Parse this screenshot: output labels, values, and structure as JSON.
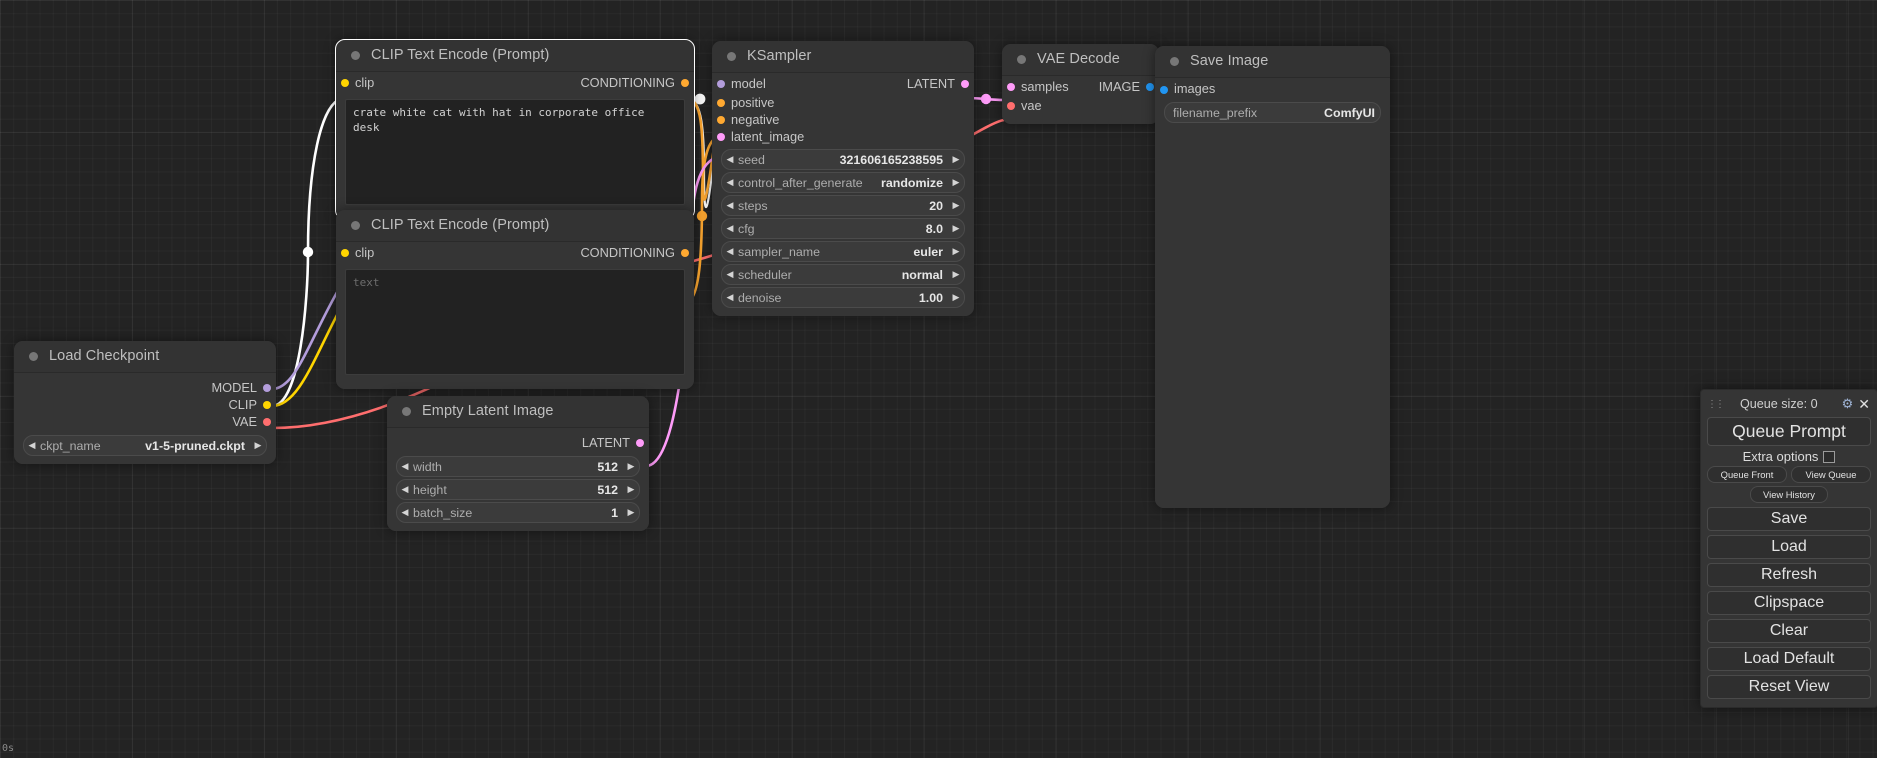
{
  "app": {
    "timer": "0s"
  },
  "nodes": {
    "load_checkpoint": {
      "title": "Load Checkpoint",
      "outputs": [
        {
          "label": "MODEL",
          "type": "model"
        },
        {
          "label": "CLIP",
          "type": "clip"
        },
        {
          "label": "VAE",
          "type": "vae"
        }
      ],
      "widgets": [
        {
          "name": "ckpt_name",
          "value": "v1-5-pruned.ckpt"
        }
      ]
    },
    "clip_positive": {
      "title": "CLIP Text Encode (Prompt)",
      "inputs": [
        {
          "label": "clip",
          "type": "clip"
        }
      ],
      "outputs": [
        {
          "label": "CONDITIONING",
          "type": "cond"
        }
      ],
      "text": "crate white cat with hat in corporate office desk",
      "text_is_placeholder": false
    },
    "clip_negative": {
      "title": "CLIP Text Encode (Prompt)",
      "inputs": [
        {
          "label": "clip",
          "type": "clip"
        }
      ],
      "outputs": [
        {
          "label": "CONDITIONING",
          "type": "cond"
        }
      ],
      "text": "text",
      "text_is_placeholder": true
    },
    "empty_latent": {
      "title": "Empty Latent Image",
      "outputs": [
        {
          "label": "LATENT",
          "type": "latent"
        }
      ],
      "widgets": [
        {
          "name": "width",
          "value": "512"
        },
        {
          "name": "height",
          "value": "512"
        },
        {
          "name": "batch_size",
          "value": "1"
        }
      ]
    },
    "ksampler": {
      "title": "KSampler",
      "inputs": [
        {
          "label": "model",
          "type": "model"
        },
        {
          "label": "positive",
          "type": "cond"
        },
        {
          "label": "negative",
          "type": "cond"
        },
        {
          "label": "latent_image",
          "type": "latent"
        }
      ],
      "outputs": [
        {
          "label": "LATENT",
          "type": "latent"
        }
      ],
      "widgets": [
        {
          "name": "seed",
          "value": "321606165238595"
        },
        {
          "name": "control_after_generate",
          "value": "randomize"
        },
        {
          "name": "steps",
          "value": "20"
        },
        {
          "name": "cfg",
          "value": "8.0"
        },
        {
          "name": "sampler_name",
          "value": "euler"
        },
        {
          "name": "scheduler",
          "value": "normal"
        },
        {
          "name": "denoise",
          "value": "1.00"
        }
      ]
    },
    "vae_decode": {
      "title": "VAE Decode",
      "inputs": [
        {
          "label": "samples",
          "type": "latent"
        },
        {
          "label": "vae",
          "type": "vae"
        }
      ],
      "outputs": [
        {
          "label": "IMAGE",
          "type": "image"
        }
      ]
    },
    "save_image": {
      "title": "Save Image",
      "inputs": [
        {
          "label": "images",
          "type": "image"
        }
      ],
      "widgets": [
        {
          "name": "filename_prefix",
          "value": "ComfyUI"
        }
      ]
    }
  },
  "menu": {
    "queue_size_label": "Queue size: 0",
    "gear_icon": "gear-icon",
    "close_icon": "close-icon",
    "queue_prompt": "Queue Prompt",
    "extra_options": "Extra options",
    "queue_front": "Queue Front",
    "view_queue": "View Queue",
    "view_history": "View History",
    "save": "Save",
    "load": "Load",
    "refresh": "Refresh",
    "clipspace": "Clipspace",
    "clear": "Clear",
    "load_default": "Load Default",
    "reset_view": "Reset View"
  },
  "colors": {
    "clip": "#FFD500",
    "model": "#B39DDB",
    "vae": "#FF6E6E",
    "conditioning": "#FFA931",
    "latent": "#FF9CF9",
    "image": "#2196F3",
    "node_bg": "#353535",
    "canvas_bg": "#232323"
  }
}
